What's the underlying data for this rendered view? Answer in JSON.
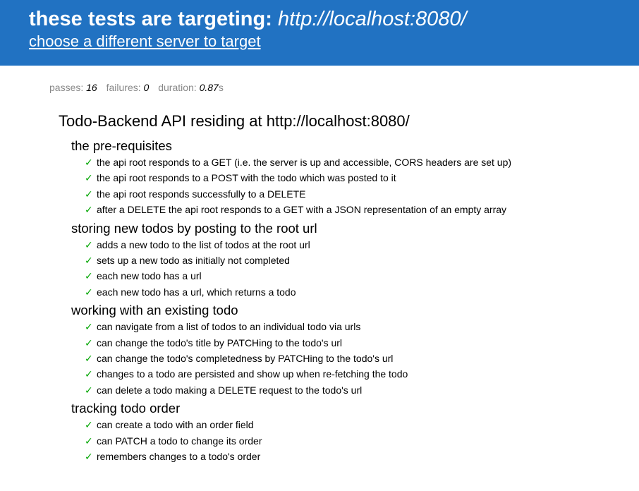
{
  "header": {
    "title_prefix": "these tests are targeting:",
    "target_url": "http://localhost:8080/",
    "change_link": "choose a different server to target"
  },
  "stats": {
    "passes_label": "passes:",
    "passes": "16",
    "failures_label": "failures:",
    "failures": "0",
    "duration_label": "duration:",
    "duration": "0.87",
    "duration_unit": "s"
  },
  "suite": {
    "title": "Todo-Backend API residing at http://localhost:8080/",
    "check_glyph": "✓",
    "groups": [
      {
        "title": "the pre-requisites",
        "tests": [
          "the api root responds to a GET (i.e. the server is up and accessible, CORS headers are set up)",
          "the api root responds to a POST with the todo which was posted to it",
          "the api root responds successfully to a DELETE",
          "after a DELETE the api root responds to a GET with a JSON representation of an empty array"
        ]
      },
      {
        "title": "storing new todos by posting to the root url",
        "tests": [
          "adds a new todo to the list of todos at the root url",
          "sets up a new todo as initially not completed",
          "each new todo has a url",
          "each new todo has a url, which returns a todo"
        ]
      },
      {
        "title": "working with an existing todo",
        "tests": [
          "can navigate from a list of todos to an individual todo via urls",
          "can change the todo's title by PATCHing to the todo's url",
          "can change the todo's completedness by PATCHing to the todo's url",
          "changes to a todo are persisted and show up when re-fetching the todo",
          "can delete a todo making a DELETE request to the todo's url"
        ]
      },
      {
        "title": "tracking todo order",
        "tests": [
          "can create a todo with an order field",
          "can PATCH a todo to change its order",
          "remembers changes to a todo's order"
        ]
      }
    ]
  },
  "colors": {
    "header_bg": "#2172c2",
    "pass_check": "#00a500",
    "stats_label": "#888888"
  }
}
